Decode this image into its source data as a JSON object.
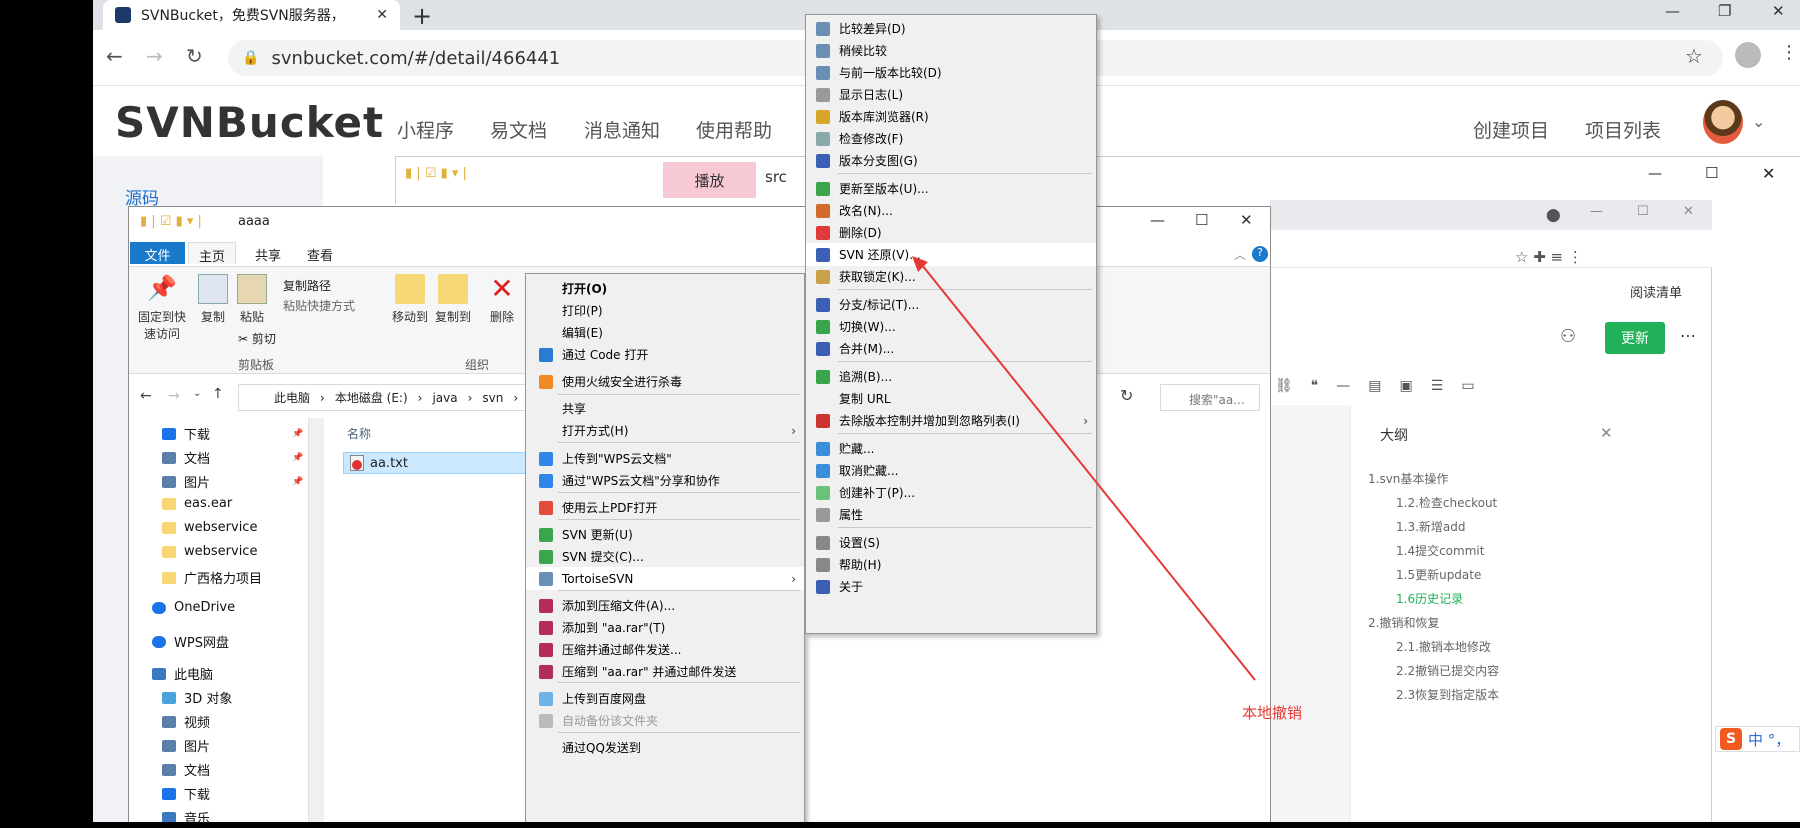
{
  "browser": {
    "tab_title": "SVNBucket，免费SVN服务器，",
    "url": "svnbucket.com/#/detail/466441"
  },
  "site": {
    "logo": "SVNBucket",
    "nav": [
      "小程序",
      "易文档",
      "消息通知",
      "使用帮助"
    ],
    "nav_right": [
      "创建项目",
      "项目列表"
    ],
    "sidebar_item": "源码"
  },
  "bg_window": {
    "tab_label": "播放",
    "src_label": "src"
  },
  "inner_browser": {
    "read_list": "阅读清单",
    "update_button": "更新",
    "outline_title": "大纲",
    "outline": [
      {
        "label": "1.svn基本操作",
        "level": 1,
        "active": false
      },
      {
        "label": "1.2.检查checkout",
        "level": 2,
        "active": false
      },
      {
        "label": "1.3.新增add",
        "level": 2,
        "active": false
      },
      {
        "label": "1.4提交commit",
        "level": 2,
        "active": false
      },
      {
        "label": "1.5更新update",
        "level": 2,
        "active": false
      },
      {
        "label": "1.6历史记录",
        "level": 2,
        "active": true
      },
      {
        "label": "2.撤销和恢复",
        "level": 1,
        "active": false
      },
      {
        "label": "2.1.撤销本地修改",
        "level": 2,
        "active": false
      },
      {
        "label": "2.2撤销已提交内容",
        "level": 2,
        "active": false
      },
      {
        "label": "2.3恢复到指定版本",
        "level": 2,
        "active": false
      }
    ]
  },
  "explorer": {
    "title": "aaaa",
    "ribbon_tabs": [
      "文件",
      "主页",
      "共享",
      "查看"
    ],
    "ribbon": {
      "pin": "固定到快速访问",
      "copy": "复制",
      "paste": "粘贴",
      "copy_path": "复制路径",
      "paste_shortcut": "粘贴快捷方式",
      "cut": "剪切",
      "clipboard_group": "剪贴板",
      "move_to": "移动到",
      "copy_to": "复制到",
      "delete": "删除",
      "organize_group": "组织"
    },
    "breadcrumb": [
      "此电脑",
      "本地磁盘 (E:)",
      "java",
      "svn"
    ],
    "search_placeholder": "搜索\"aa...",
    "nav_items": [
      "下载",
      "文档",
      "图片",
      "eas.ear",
      "webservice",
      "webservice",
      "广西格力项目",
      "OneDrive",
      "WPS网盘",
      "此电脑",
      "3D 对象",
      "视频",
      "图片",
      "文档",
      "下载",
      "音乐"
    ],
    "column_name": "名称",
    "file": "aa.txt"
  },
  "context_menu": [
    {
      "label": "打开(O)",
      "bold": true
    },
    {
      "label": "打印(P)"
    },
    {
      "label": "编辑(E)"
    },
    {
      "label": "通过 Code 打开"
    },
    {
      "label": "使用火绒安全进行杀毒"
    },
    {
      "label": "共享"
    },
    {
      "label": "打开方式(H)",
      "submenu": true
    },
    {
      "label": "上传到\"WPS云文档\""
    },
    {
      "label": "通过\"WPS云文档\"分享和协作"
    },
    {
      "label": "使用云上PDF打开"
    },
    {
      "label": "SVN 更新(U)"
    },
    {
      "label": "SVN 提交(C)..."
    },
    {
      "label": "TortoiseSVN",
      "submenu": true,
      "highlight": true
    },
    {
      "label": "添加到压缩文件(A)..."
    },
    {
      "label": "添加到 \"aa.rar\"(T)"
    },
    {
      "label": "压缩并通过邮件发送..."
    },
    {
      "label": "压缩到 \"aa.rar\" 并通过邮件发送"
    },
    {
      "label": "上传到百度网盘"
    },
    {
      "label": "自动备份该文件夹",
      "disabled": true
    },
    {
      "label": "通过QQ发送到"
    }
  ],
  "svn_menu": [
    {
      "label": "比较差异(D)"
    },
    {
      "label": "稍候比较"
    },
    {
      "label": "与前一版本比较(D)"
    },
    {
      "label": "显示日志(L)"
    },
    {
      "label": "版本库浏览器(R)"
    },
    {
      "label": "检查修改(F)"
    },
    {
      "label": "版本分支图(G)"
    },
    {
      "label": "更新至版本(U)..."
    },
    {
      "label": "改名(N)..."
    },
    {
      "label": "删除(D)"
    },
    {
      "label": "SVN 还原(V)...",
      "highlight": true
    },
    {
      "label": "获取锁定(K)..."
    },
    {
      "label": "分支/标记(T)..."
    },
    {
      "label": "切换(W)..."
    },
    {
      "label": "合并(M)..."
    },
    {
      "label": "追溯(B)..."
    },
    {
      "label": "复制 URL"
    },
    {
      "label": "去除版本控制并增加到忽略列表(I)",
      "submenu": true
    },
    {
      "label": "贮藏..."
    },
    {
      "label": "取消贮藏..."
    },
    {
      "label": "创建补丁(P)..."
    },
    {
      "label": "属性"
    },
    {
      "label": "设置(S)"
    },
    {
      "label": "帮助(H)"
    },
    {
      "label": "关于"
    }
  ],
  "annotation": "本地撤销",
  "ime": "中 °，"
}
